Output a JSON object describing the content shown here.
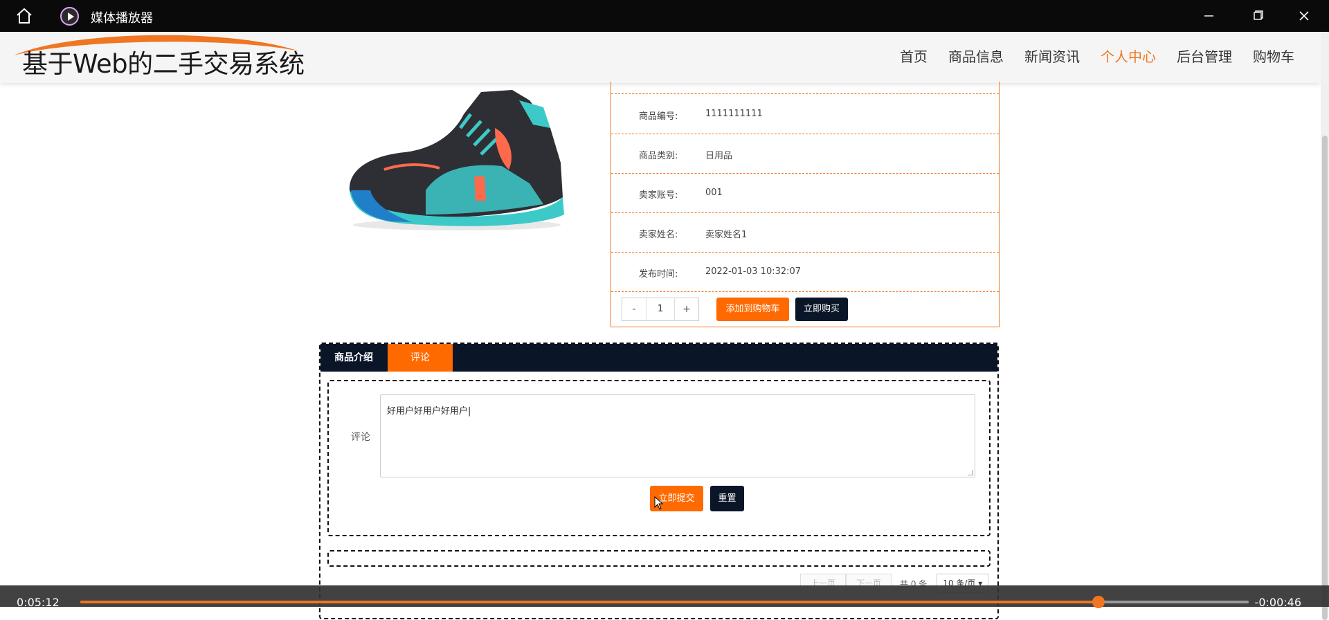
{
  "window": {
    "app_title": "媒体播放器"
  },
  "site": {
    "logo": "基于Web的二手交易系统",
    "nav": [
      "首页",
      "商品信息",
      "新闻资讯",
      "个人中心",
      "后台管理",
      "购物车"
    ],
    "active_nav": "个人中心",
    "accent_color": "#f07621"
  },
  "product": {
    "fields": [
      {
        "label": "商品编号:",
        "value": "1111111111"
      },
      {
        "label": "商品类别:",
        "value": "日用品"
      },
      {
        "label": "卖家账号:",
        "value": "001"
      },
      {
        "label": "卖家姓名:",
        "value": "卖家姓名1"
      },
      {
        "label": "发布时间:",
        "value": "2022-01-03 10:32:07"
      }
    ],
    "quantity": {
      "minus": "-",
      "value": "1",
      "plus": "+"
    },
    "add_cart_label": "添加到购物车",
    "buy_now_label": "立即购买"
  },
  "tabs": {
    "intro": "商品介绍",
    "comment": "评论",
    "active": "评论"
  },
  "comment_form": {
    "label": "评论",
    "text": "好用户好用户好用户|",
    "submit_label": "立即提交",
    "reset_label": "重置"
  },
  "pager": {
    "prev": "上一页",
    "next": "下一页",
    "total": "共 0 条",
    "page_size": "10 条/页"
  },
  "player": {
    "elapsed": "0:05:12",
    "remaining": "-0:00:46",
    "progress": 0.8714
  }
}
